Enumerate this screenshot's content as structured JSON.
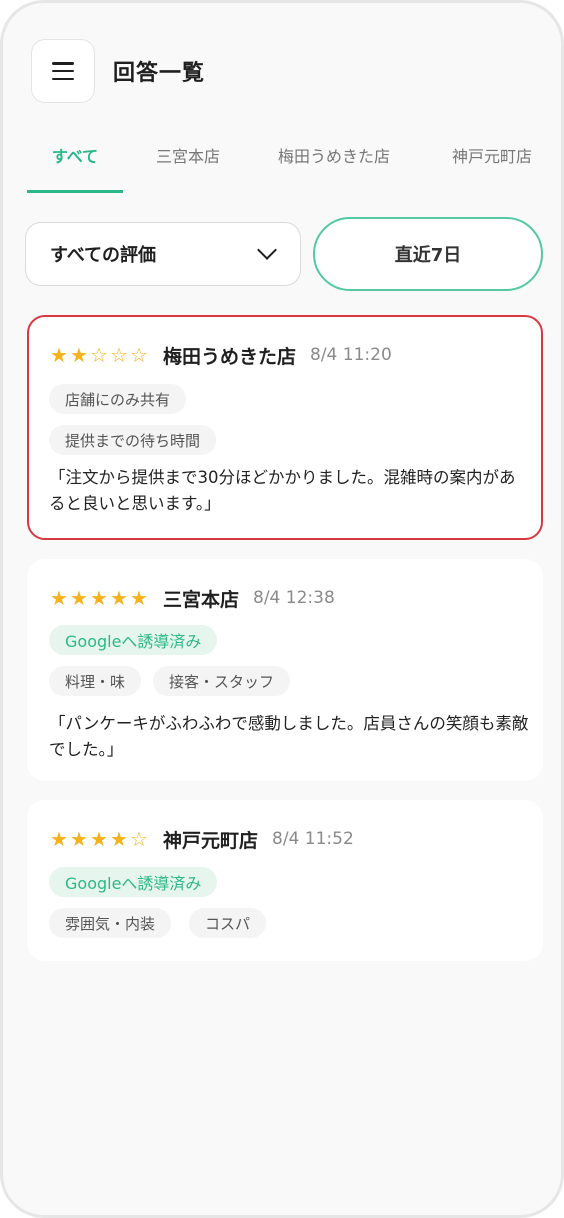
{
  "header": {
    "title": "回答一覧",
    "menu_icon": "hamburger-menu-icon"
  },
  "tabs": [
    {
      "label": "すべて",
      "active": true
    },
    {
      "label": "三宮本店",
      "active": false
    },
    {
      "label": "梅田うめきた店",
      "active": false
    },
    {
      "label": "神戸元町店",
      "active": false
    }
  ],
  "filters": {
    "rating_label": "すべての評価",
    "rating_icon": "chevron-down-icon",
    "period_label": "直近7日"
  },
  "colors": {
    "accent": "#2bb889",
    "star": "#f5b21a",
    "selected_border": "#d8383f"
  },
  "responses": [
    {
      "rating": 2,
      "store": "梅田うめきた店",
      "time": "8/4 11:20",
      "badge": "店舗にのみ共有",
      "tags": [
        "提供までの待ち時間"
      ],
      "comment": "「注文から提供まで30分ほどかかりました。混雑時の案内があると良いと思います。」",
      "selected": true
    },
    {
      "rating": 5,
      "store": "三宮本店",
      "time": "8/4 12:38",
      "badge": "Googleへ誘導済み",
      "tags": [
        "料理・味",
        "接客・スタッフ"
      ],
      "comment": "「パンケーキがふわふわで感動しました。店員さんの笑顔も素敵でした。」",
      "selected": false
    },
    {
      "rating": 4,
      "store": "神戸元町店",
      "time": "8/4 11:52",
      "badge": "Googleへ誘導済み",
      "tags": [
        "雰囲気・内装",
        "コスパ"
      ],
      "comment": "",
      "selected": false
    }
  ]
}
